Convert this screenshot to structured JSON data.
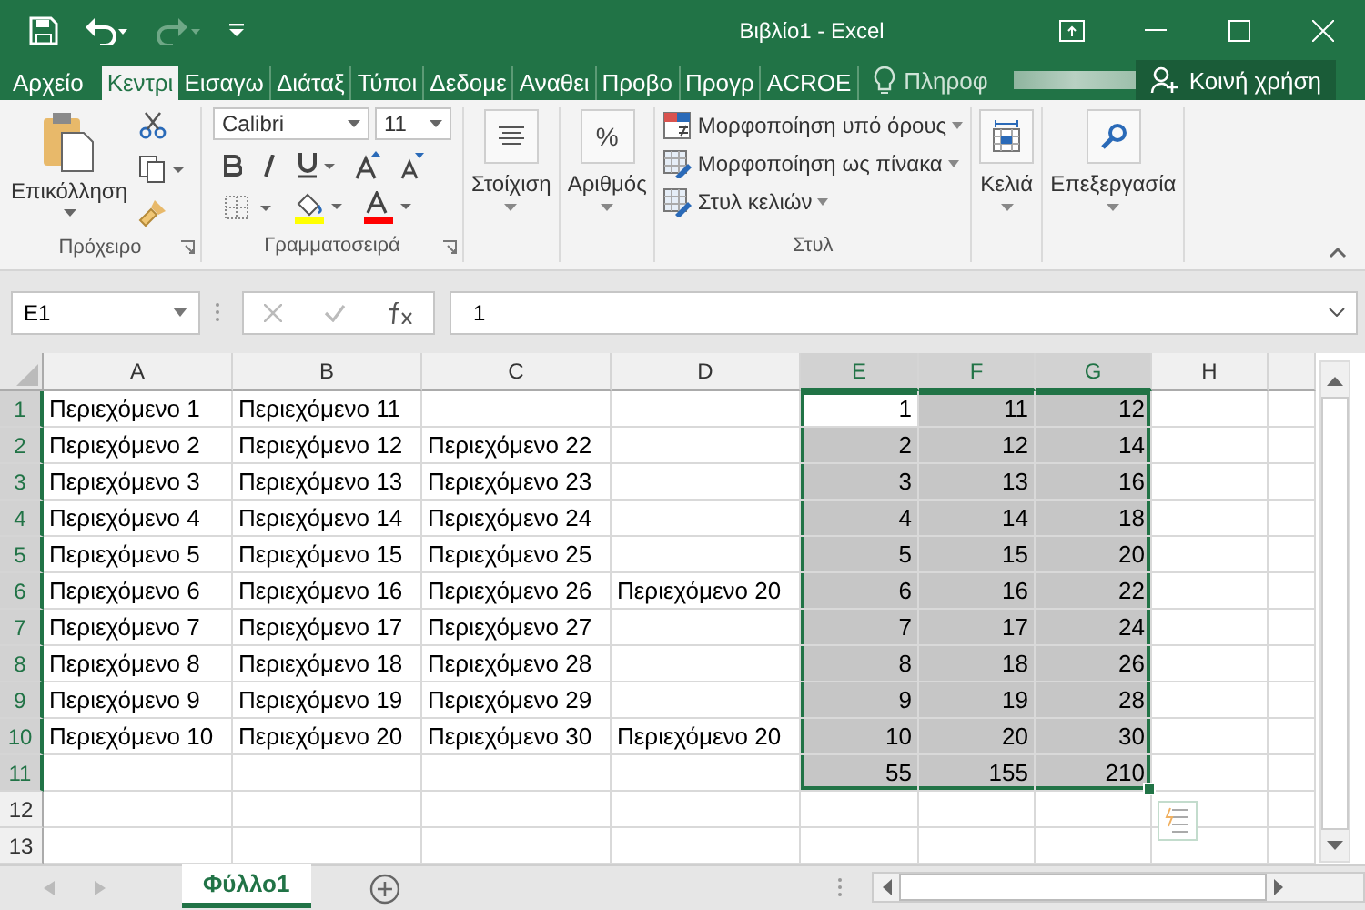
{
  "window": {
    "title": "Βιβλίο1 - Excel"
  },
  "tabs": [
    {
      "label": "Αρχείο",
      "selected": false
    },
    {
      "label": "Κεντρι",
      "selected": true
    },
    {
      "label": "Εισαγω",
      "selected": false
    },
    {
      "label": "Διάταξ",
      "selected": false
    },
    {
      "label": "Τύποι",
      "selected": false
    },
    {
      "label": "Δεδομε",
      "selected": false
    },
    {
      "label": "Αναθει",
      "selected": false
    },
    {
      "label": "Προβο",
      "selected": false
    },
    {
      "label": "Προγρ",
      "selected": false
    },
    {
      "label": "ACROE",
      "selected": false
    }
  ],
  "tell_me": {
    "placeholder": "Πληροφ"
  },
  "share": {
    "label": "Κοινή χρήση"
  },
  "ribbon": {
    "groups": [
      {
        "kind": "clipboard",
        "label": "Πρόχειρο",
        "paste": "Επικόλληση"
      },
      {
        "kind": "font",
        "label": "Γραμματοσειρά",
        "font_name": "Calibri",
        "font_size": "11"
      },
      {
        "kind": "alignment",
        "label": "Στοίχιση"
      },
      {
        "kind": "number",
        "label": "Αριθμός",
        "icon_text": "%"
      },
      {
        "kind": "styles",
        "label": "Στυλ",
        "buttons": [
          "Μορφοποίηση υπό όρους",
          "Μορφοποίηση ως πίνακα",
          "Στυλ κελιών"
        ]
      },
      {
        "kind": "cells",
        "label": "Κελιά"
      },
      {
        "kind": "editing",
        "label": "Επεξεργασία"
      }
    ]
  },
  "formula_bar": {
    "name_box": "E1",
    "formula": "1"
  },
  "columns": [
    {
      "label": "A",
      "kind": "text",
      "selected": false
    },
    {
      "label": "B",
      "kind": "text",
      "selected": false
    },
    {
      "label": "C",
      "kind": "text",
      "selected": false
    },
    {
      "label": "D",
      "kind": "text",
      "selected": false
    },
    {
      "label": "E",
      "kind": "number",
      "selected": true
    },
    {
      "label": "F",
      "kind": "number",
      "selected": true
    },
    {
      "label": "G",
      "kind": "number",
      "selected": true
    },
    {
      "label": "H",
      "kind": "number",
      "selected": false
    }
  ],
  "rows": [
    {
      "number": "1",
      "selected": true,
      "cells": [
        "Περιεχόμενο 1",
        "Περιεχόμενο 11",
        null,
        null,
        "1",
        "11",
        "12",
        null
      ]
    },
    {
      "number": "2",
      "selected": true,
      "cells": [
        "Περιεχόμενο 2",
        "Περιεχόμενο 12",
        "Περιεχόμενο 22",
        null,
        "2",
        "12",
        "14",
        null
      ]
    },
    {
      "number": "3",
      "selected": true,
      "cells": [
        "Περιεχόμενο 3",
        "Περιεχόμενο 13",
        "Περιεχόμενο 23",
        null,
        "3",
        "13",
        "16",
        null
      ]
    },
    {
      "number": "4",
      "selected": true,
      "cells": [
        "Περιεχόμενο 4",
        "Περιεχόμενο 14",
        "Περιεχόμενο 24",
        null,
        "4",
        "14",
        "18",
        null
      ]
    },
    {
      "number": "5",
      "selected": true,
      "cells": [
        "Περιεχόμενο 5",
        "Περιεχόμενο 15",
        "Περιεχόμενο 25",
        null,
        "5",
        "15",
        "20",
        null
      ]
    },
    {
      "number": "6",
      "selected": true,
      "cells": [
        "Περιεχόμενο 6",
        "Περιεχόμενο 16",
        "Περιεχόμενο 26",
        "Περιεχόμενο 20",
        "6",
        "16",
        "22",
        null
      ]
    },
    {
      "number": "7",
      "selected": true,
      "cells": [
        "Περιεχόμενο 7",
        "Περιεχόμενο 17",
        "Περιεχόμενο 27",
        null,
        "7",
        "17",
        "24",
        null
      ]
    },
    {
      "number": "8",
      "selected": true,
      "cells": [
        "Περιεχόμενο 8",
        "Περιεχόμενο 18",
        "Περιεχόμενο 28",
        null,
        "8",
        "18",
        "26",
        null
      ]
    },
    {
      "number": "9",
      "selected": true,
      "cells": [
        "Περιεχόμενο 9",
        "Περιεχόμενο 19",
        "Περιεχόμενο 29",
        null,
        "9",
        "19",
        "28",
        null
      ]
    },
    {
      "number": "10",
      "selected": true,
      "cells": [
        "Περιεχόμενο 10",
        "Περιεχόμενο 20",
        "Περιεχόμενο 30",
        "Περιεχόμενο 20",
        "10",
        "20",
        "30",
        null
      ]
    },
    {
      "number": "11",
      "selected": true,
      "cells": [
        null,
        null,
        null,
        null,
        "55",
        "155",
        "210",
        null
      ]
    },
    {
      "number": "12",
      "selected": false,
      "cells": [
        null,
        null,
        null,
        null,
        null,
        null,
        null,
        null
      ]
    },
    {
      "number": "13",
      "selected": false,
      "cells": [
        null,
        null,
        null,
        null,
        null,
        null,
        null,
        null
      ]
    }
  ],
  "sheets": [
    {
      "label": "Φύλλο1",
      "selected": true
    }
  ]
}
